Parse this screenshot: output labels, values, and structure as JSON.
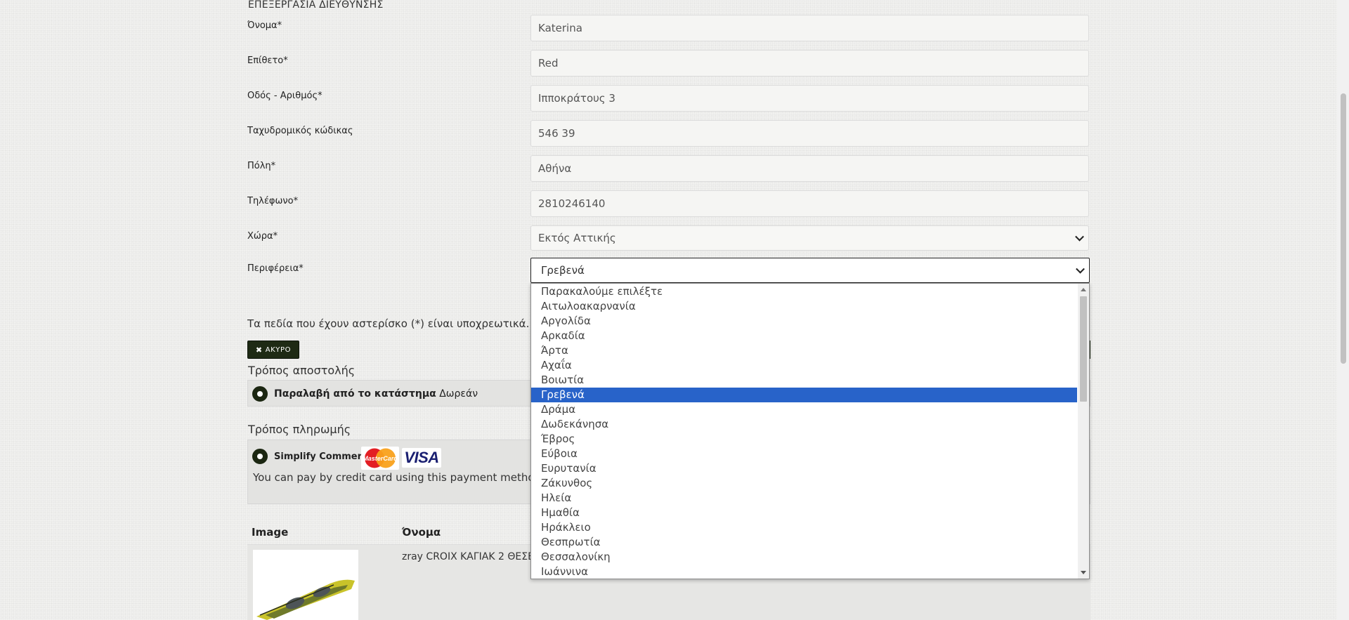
{
  "section_title": "ΕΠΕΞΕΡΓΑΣΙΑ ΔΙΕΥΘΥΝΣΗΣ",
  "form": {
    "first_name": {
      "label": "Όνομα*",
      "value": "Katerina"
    },
    "last_name": {
      "label": "Επίθετο*",
      "value": "Red"
    },
    "street": {
      "label": "Οδός - Αριθμός*",
      "value": "Ιπποκράτους 3"
    },
    "postcode": {
      "label": "Ταχυδρομικός κώδικας",
      "value": "546 39"
    },
    "city": {
      "label": "Πόλη*",
      "value": "Αθήνα"
    },
    "phone": {
      "label": "Τηλέφωνο*",
      "value": "2810246140"
    },
    "country": {
      "label": "Χώρα*",
      "value": "Εκτός Αττικής"
    },
    "region": {
      "label": "Περιφέρεια*",
      "value": "Γρεβενά"
    }
  },
  "required_note": "Τα πεδία που έχουν αστερίσκο (*) είναι υποχρεωτικά.",
  "cancel_button": "ΑΚΥΡΟ",
  "shipping": {
    "title": "Τρόπος αποστολής",
    "option_name": "Παραλαβή από το κατάστημα",
    "option_price": "Δωρεάν"
  },
  "payment": {
    "title": "Τρόπος πληρωμής",
    "option_name": "Simplify Commerce",
    "description": "You can pay by credit card using this payment method",
    "mastercard_text": "MasterCard",
    "visa_text": "VISA"
  },
  "cart_table": {
    "headers": [
      "Image",
      "Όνομα"
    ],
    "rows": [
      {
        "name": "zray CROIX ΚΑΓΙΑΚ 2 ΘΕΣΕ"
      }
    ]
  },
  "region_dropdown": {
    "selected_index": 7,
    "options": [
      "Παρακαλούμε επιλέξτε",
      "Αιτωλοακαρνανία",
      "Αργολίδα",
      "Αρκαδία",
      "Άρτα",
      "Αχαΐα",
      "Βοιωτία",
      "Γρεβενά",
      "Δράμα",
      "Δωδεκάνησα",
      "Έβρος",
      "Εύβοια",
      "Ευρυτανία",
      "Ζάκυνθος",
      "Ηλεία",
      "Ημαθία",
      "Ηράκλειο",
      "Θεσπρωτία",
      "Θεσσαλονίκη",
      "Ιωάννινα"
    ]
  },
  "colors": {
    "accent_dark": "#1e2a14",
    "selection_blue": "#2863c9",
    "visa_blue": "#1a1f71"
  }
}
